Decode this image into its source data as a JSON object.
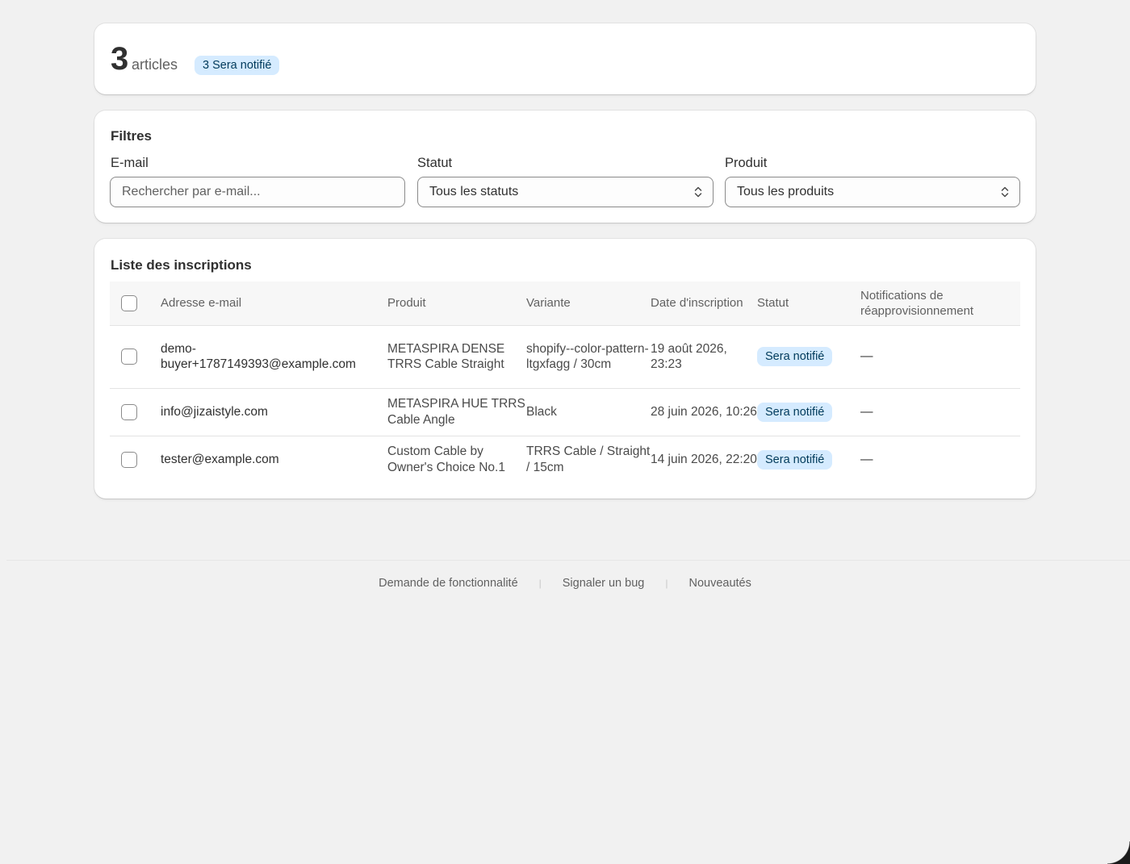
{
  "summary": {
    "count": "3",
    "unit": "articles",
    "badge": "3 Sera notifié"
  },
  "filters": {
    "title": "Filtres",
    "email_label": "E-mail",
    "email_placeholder": "Rechercher par e-mail...",
    "status_label": "Statut",
    "status_value": "Tous les statuts",
    "product_label": "Produit",
    "product_value": "Tous les produits"
  },
  "list": {
    "title": "Liste des inscriptions",
    "headers": {
      "email": "Adresse e-mail",
      "product": "Produit",
      "variant": "Variante",
      "date": "Date d'inscription",
      "status": "Statut",
      "notifications": "Notifications de réapprovisionnement"
    },
    "rows": [
      {
        "email": "demo-buyer+1787149393@example.com",
        "product": "METASPIRA DENSE TRRS Cable Straight",
        "variant": "shopify--color-pattern-ltgxfagg / 30cm",
        "date": "19 août 2026, 23:23",
        "status": "Sera notifié",
        "notifications": "—"
      },
      {
        "email": "info@jizaistyle.com",
        "product": "METASPIRA HUE TRRS Cable Angle",
        "variant": "Black",
        "date": "28 juin 2026, 10:26",
        "status": "Sera notifié",
        "notifications": "—"
      },
      {
        "email": "tester@example.com",
        "product": "Custom Cable by Owner's Choice No.1",
        "variant": "TRRS Cable / Straight / 15cm",
        "date": "14 juin 2026, 22:20",
        "status": "Sera notifié",
        "notifications": "—"
      }
    ]
  },
  "footer": {
    "links": [
      "Demande de fonctionnalité",
      "Signaler un bug",
      "Nouveautés"
    ]
  },
  "colors": {
    "background": "#f1f1f1",
    "card": "#ffffff",
    "badge_bg": "#d5ebff",
    "badge_text": "#003a5a"
  },
  "icons": {
    "select_chevron": "select-chevron-icon",
    "checkbox": "checkbox-icon"
  }
}
